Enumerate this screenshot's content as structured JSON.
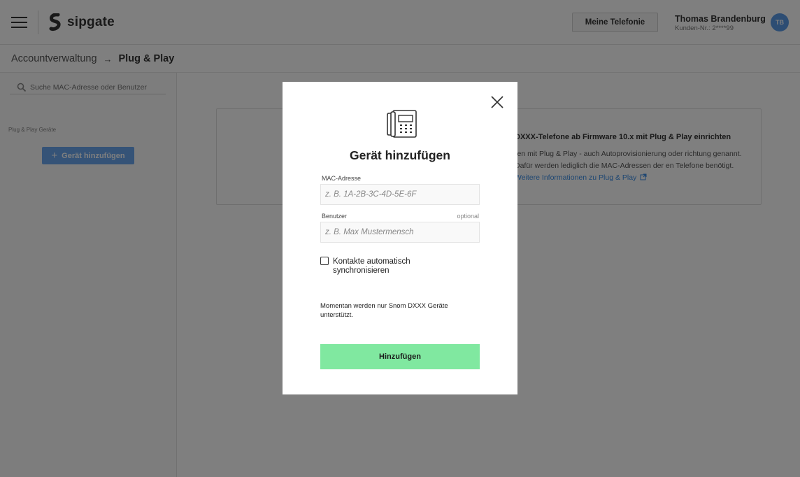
{
  "header": {
    "logo_text": "sipgate",
    "meine_telefonie_label": "Meine Telefonie",
    "user_name": "Thomas Brandenburg",
    "customer_number": "Kunden-Nr.: 2****99",
    "avatar_initials": "TB"
  },
  "breadcrumb": {
    "parent": "Accountverwaltung",
    "current": "Plug & Play"
  },
  "sidebar": {
    "search_placeholder": "Suche MAC-Adresse oder Benutzer",
    "section_label": "Plug & Play Geräte",
    "add_button_label": "Gerät hinzufügen"
  },
  "info_card": {
    "title": "DXXX-Telefone ab Firmware 10.x mit Plug & Play einrichten",
    "text": "ren mit Plug & Play - auch Autoprovisionierung oder richtung genannt. Dafür werden lediglich die MAC-Adressen der en Telefone benötigt.",
    "link": "Weitere Informationen zu Plug & Play"
  },
  "modal": {
    "title": "Gerät hinzufügen",
    "mac_label": "MAC-Adresse",
    "mac_placeholder": "z. B. 1A-2B-3C-4D-5E-6F",
    "user_label": "Benutzer",
    "user_optional": "optional",
    "user_placeholder": "z. B. Max Mustermensch",
    "sync_label": "Kontakte automatisch synchronisieren",
    "sync_checked": false,
    "note": "Momentan werden nur Snom DXXX Geräte unterstützt.",
    "submit_label": "Hinzufügen"
  },
  "colors": {
    "accent_blue": "#6aa6ee",
    "link_blue": "#3b8de4",
    "submit_green": "#80e8a0",
    "avatar_blue": "#5b9be6"
  },
  "icons": {
    "menu": "hamburger-icon",
    "search": "search-icon",
    "close": "close-icon",
    "phone": "desk-phone-icon",
    "external": "external-link-icon"
  }
}
